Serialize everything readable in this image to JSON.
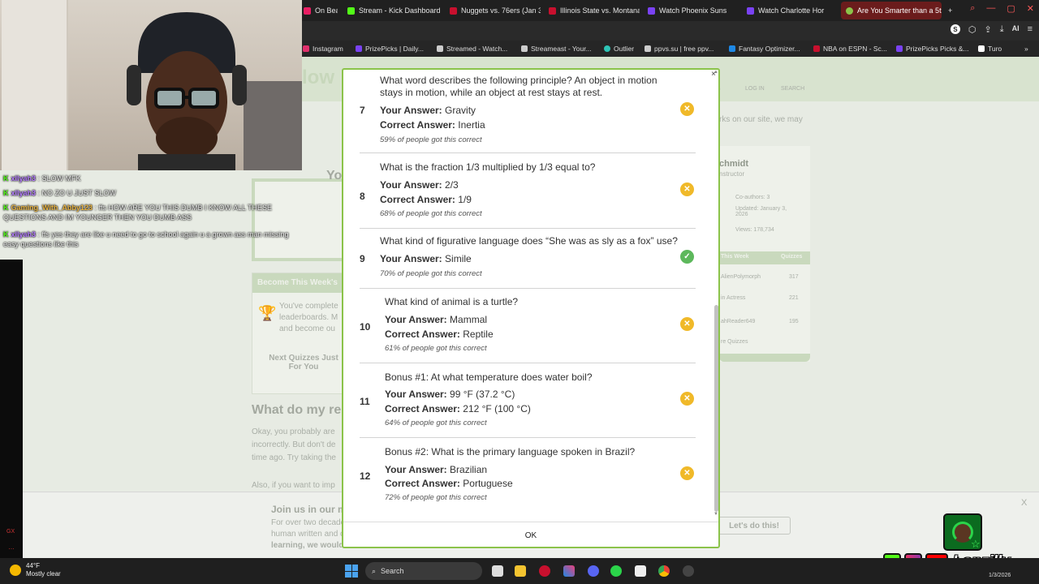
{
  "browser": {
    "tabs": [
      {
        "label": "On Beat C",
        "active": false,
        "color": "#e91e63"
      },
      {
        "label": "Stream - Kick Dashboard",
        "active": false,
        "color": "#53fc18"
      },
      {
        "label": "Nuggets vs. 76ers (Jan 3",
        "active": false,
        "color": "#c8102e"
      },
      {
        "label": "Illinois State vs. Montana",
        "active": false,
        "color": "#c8102e"
      },
      {
        "label": "Watch Phoenix Suns",
        "active": false,
        "color": "#7a42f4"
      },
      {
        "label": "Watch Charlotte Hor",
        "active": false,
        "color": "#7a42f4"
      },
      {
        "label": "Are You Smarter than a 5th",
        "active": true,
        "color": "#8bc34a"
      }
    ],
    "new_tab": "+",
    "toolbar_ai": "AI",
    "bookmarks": [
      {
        "label": "Instagram",
        "color": "#e1306c"
      },
      {
        "label": "PrizePicks | Daily...",
        "color": "#7a42f4"
      },
      {
        "label": "Streamed - Watch...",
        "color": "#cccccc"
      },
      {
        "label": "Streameast - Your...",
        "color": "#cccccc"
      },
      {
        "label": "Outlier",
        "color": "#2ec4b6"
      },
      {
        "label": "ppvs.su | free ppv...",
        "color": "#cccccc"
      },
      {
        "label": "Fantasy Optimizer...",
        "color": "#1e88e5"
      },
      {
        "label": "NBA on ESPN - Sc...",
        "color": "#c8102e"
      },
      {
        "label": "PrizePicks Picks &...",
        "color": "#7a42f4"
      },
      {
        "label": "Turo",
        "color": "#ffffff"
      }
    ]
  },
  "background_page": {
    "header_title": "low",
    "left_heading": "Yo",
    "become_heading": "Become This Week's",
    "become_text_1": "You've complete",
    "become_text_2": "leaderboards. M",
    "become_text_3": "and become ou",
    "next_quizzes": "Next Quizzes Just For You",
    "section_heading": "What do my re",
    "para_1": "Okay, you probably are",
    "para_2": "incorrectly. But don't de",
    "para_3": "time ago. Try taking the",
    "para_4": "Also, if you want to imp",
    "join_heading": "Join us in our m",
    "join_text_1": "For over two decade",
    "join_text_2": "human written and c",
    "join_text_3": "learning, we would",
    "join_button": "Let's do this!",
    "join_close": "X",
    "top_notice": "rks on our site, we may",
    "author_name": "chmidt",
    "author_role": "nstructor",
    "coauthors": "Co-authors: 3",
    "updated": "Updated: January 3, 2026",
    "views": "Views: 178,734",
    "top_week": "This Week",
    "top_score_label": "Quizzes",
    "leaders": [
      {
        "name": "AlienPolymorph",
        "score": "317"
      },
      {
        "name": "in Actress",
        "score": "221"
      },
      {
        "name": "ahReader649",
        "score": "195"
      }
    ],
    "more_quizzes": "re Quizzes",
    "top_icons": [
      "s",
      "LOG IN",
      "SEARCH"
    ]
  },
  "chat": [
    {
      "user": "xllyah3",
      "user_color": "purple",
      "message": ": SLOW MFK"
    },
    {
      "user": "xllyah3",
      "user_color": "purple",
      "message": ": NO ZO U JUST SLOW"
    },
    {
      "user": "Gaming_With_Abby123",
      "user_color": "gold",
      "message": ": ffs HOW ARE YOU THIS DUMB I KNOW ALL THESE QUESTIONS AND IM YOUNGER THEN YOU DUMB ASS"
    },
    {
      "user": "xllyah3",
      "user_color": "purple",
      "message": ": ffs yes they are like u need to go to school again u a grown ass man missing easy questions like this"
    }
  ],
  "results": {
    "answer_label": "Your Answer:",
    "correct_label": "Correct Answer:",
    "items": [
      {
        "number": "7",
        "question": "What word describes the following principle? An object in motion stays in motion, while an object at rest stays at rest.",
        "your_answer": "Gravity",
        "correct_answer": "Inertia",
        "percent": "59% of people got this correct",
        "status": "wrong"
      },
      {
        "number": "8",
        "question": "What is the fraction 1/3 multiplied by 1/3 equal to?",
        "your_answer": "2/3",
        "correct_answer": "1/9",
        "percent": "68% of people got this correct",
        "status": "wrong"
      },
      {
        "number": "9",
        "question": "What kind of figurative language does “She was as sly as a fox” use?",
        "your_answer": "Simile",
        "correct_answer": null,
        "percent": "70% of people got this correct",
        "status": "right"
      },
      {
        "number": "10",
        "question": "What kind of animal is a turtle?",
        "your_answer": "Mammal",
        "correct_answer": "Reptile",
        "percent": "61% of people got this correct",
        "status": "wrong"
      },
      {
        "number": "11",
        "question": "Bonus #1: At what temperature does water boil?",
        "your_answer": "99 °F (37.2 °C)",
        "correct_answer": "212 °F (100 °C)",
        "percent": "64% of people got this correct",
        "status": "wrong"
      },
      {
        "number": "12",
        "question": "Bonus #2: What is the primary language spoken in Brazil?",
        "your_answer": "Brazilian",
        "correct_answer": "Portuguese",
        "percent": "72% of people got this correct",
        "status": "wrong"
      }
    ],
    "ok_label": "OK",
    "close_label": "×"
  },
  "brand": {
    "handle": "Lonzilly",
    "kick": "K",
    "instagram": "◎",
    "youtube": "▶"
  },
  "taskbar": {
    "temperature": "44°F",
    "weather": "Mostly clear",
    "search_placeholder": "Search",
    "date": "1/3/2026"
  },
  "colors": {
    "accent_green": "#8bc34a",
    "wrong": "#f0b929",
    "right": "#5db85c"
  }
}
